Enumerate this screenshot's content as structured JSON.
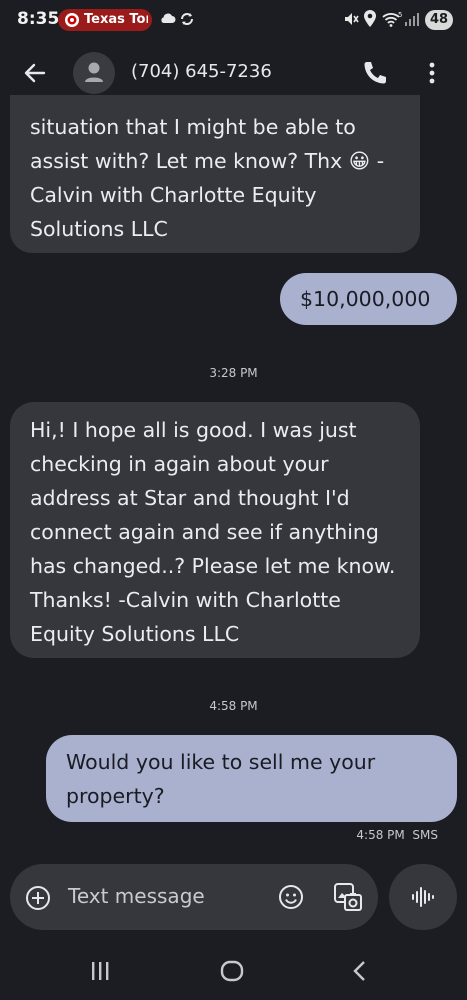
{
  "status_bar": {
    "time": "8:35",
    "notification_label": "Texas Tor",
    "battery": "48",
    "wifi_badge": "5"
  },
  "header": {
    "contact": "(704) 645-7236"
  },
  "messages": [
    {
      "direction": "incoming",
      "lines": [
        "situation that I might be able to",
        "assist with? Let me know? Thx 😀 -",
        "Calvin with Charlotte Equity",
        "Solutions LLC"
      ]
    },
    {
      "direction": "outgoing",
      "lines": [
        "$10,000,000"
      ]
    },
    {
      "direction": "incoming",
      "lines": [
        "Hi,! I hope all is good. I was just",
        "checking in again about your",
        "address at Star and thought I'd",
        "connect again and see if anything",
        "has changed..? Please let me know.",
        "Thanks! -Calvin with Charlotte",
        "Equity Solutions LLC"
      ]
    },
    {
      "direction": "outgoing",
      "lines": [
        "Would you like to sell me your",
        "property?"
      ]
    }
  ],
  "timestamps": [
    "3:28 PM",
    "4:58 PM"
  ],
  "last_message_meta": "4:58 PM  SMS",
  "compose": {
    "placeholder": "Text message"
  },
  "colors": {
    "background": "#1c1d22",
    "incoming_bubble": "#36373d",
    "outgoing_bubble": "#a9b1cf",
    "notification_pill": "#9b1b1b"
  }
}
